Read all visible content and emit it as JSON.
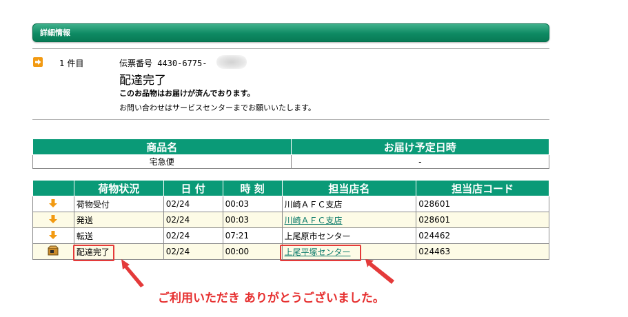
{
  "section": {
    "title": "詳細情報"
  },
  "summary": {
    "count": "1 件目",
    "denpyo_label": "伝票番号 4430-6775-",
    "status": "配達完了",
    "message1": "このお品物はお届けが済んでおります。",
    "message2": "お問い合わせはサービスセンターまでお願いいたします。"
  },
  "product_table": {
    "headers": [
      "商品名",
      "お届け予定日時"
    ],
    "row": [
      "宅急便",
      "-"
    ]
  },
  "tracking_table": {
    "headers": [
      "荷物状況",
      "日 付",
      "時 刻",
      "担当店名",
      "担当店コード"
    ],
    "rows": [
      {
        "icon": "down-arrow-icon",
        "status": "荷物受付",
        "date": "02/24",
        "time": "00:03",
        "store": "川崎ＡＦＣ支店",
        "store_link": false,
        "code": "028601"
      },
      {
        "icon": "down-arrow-icon",
        "status": "発送",
        "date": "02/24",
        "time": "00:03",
        "store": "川崎ＡＦＣ支店",
        "store_link": true,
        "code": "028601"
      },
      {
        "icon": "down-arrow-icon",
        "status": "転送",
        "date": "02/24",
        "time": "07:21",
        "store": "上尾原市センター",
        "store_link": false,
        "code": "024462"
      },
      {
        "icon": "package-icon",
        "status": "配達完了",
        "date": "02/24",
        "time": "00:00",
        "store": "上尾平塚センター",
        "store_link": true,
        "code": "024463"
      }
    ]
  },
  "annotation": {
    "thanks": "ご利用いただき ありがとうございました。"
  },
  "colors": {
    "header_green": "#0a9a77",
    "arrow_orange": "#f29a12",
    "annotation_red": "#e43a3a"
  }
}
